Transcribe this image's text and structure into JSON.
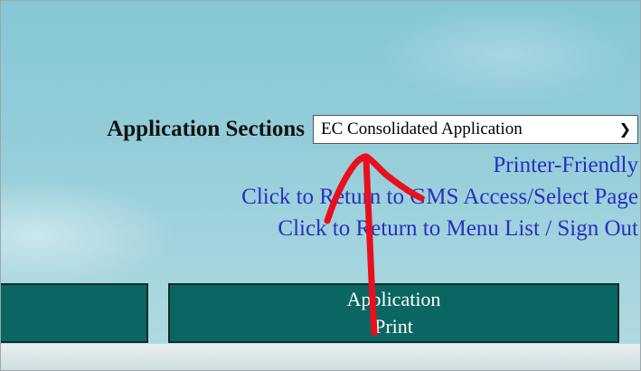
{
  "sections": {
    "label": "Application Sections",
    "selected": "EC Consolidated Application"
  },
  "links": {
    "printer_friendly": "Printer-Friendly",
    "return_gms": "Click to Return to GMS Access/Select Page",
    "return_menu": "Click to Return to Menu List / Sign Out"
  },
  "buttons": {
    "left_label": "",
    "application_line1": "Application",
    "application_line2": "Print"
  },
  "annotation": {
    "stroke_color": "#e8101c",
    "icon": "hand-drawn-red-arrow"
  },
  "colors": {
    "button_bg": "#0b6662",
    "link": "#2a2fc0"
  }
}
